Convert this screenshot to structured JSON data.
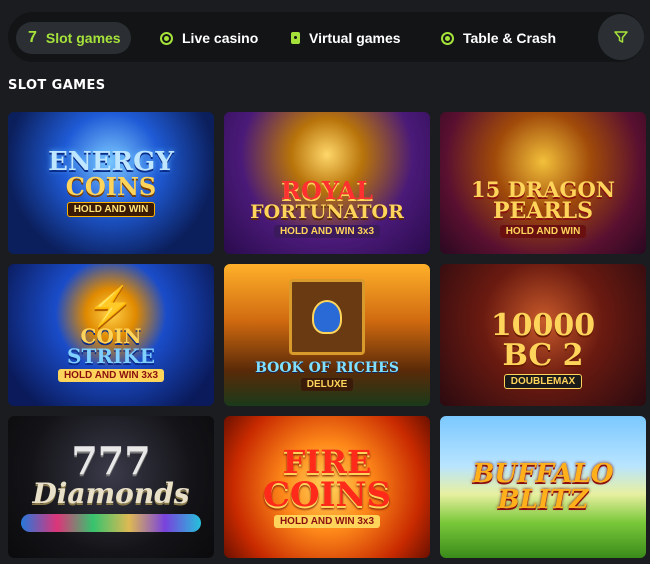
{
  "nav": {
    "tabs": [
      {
        "label": "Slot games",
        "icon": "seven-icon",
        "glyph": "7",
        "active": true
      },
      {
        "label": "Live casino",
        "icon": "live-icon",
        "active": false
      },
      {
        "label": "Virtual games",
        "icon": "dice-icon",
        "active": false
      },
      {
        "label": "Table & Crash",
        "icon": "chip-icon",
        "active": false
      }
    ],
    "filter_icon": "filter-icon"
  },
  "section": {
    "title": "SLOT GAMES"
  },
  "games": [
    {
      "title": "ENERGY",
      "subtitle": "COINS",
      "tagline": "HOLD AND WIN"
    },
    {
      "title": "ROYAL",
      "subtitle": "FORTUNATOR",
      "tagline": "HOLD AND WIN 3x3"
    },
    {
      "title": "15 DRAGON",
      "subtitle": "PEARLS",
      "tagline": "HOLD AND WIN"
    },
    {
      "title": "COIN",
      "subtitle": "STRIKE",
      "tagline": "HOLD AND WIN 3x3"
    },
    {
      "title": "BOOK OF RICHES",
      "subtitle": "DELUXE",
      "tagline": ""
    },
    {
      "title": "10000",
      "subtitle": "BC 2",
      "tagline": "DOUBLEMAX"
    },
    {
      "title": "777",
      "subtitle": "Diamonds",
      "tagline": ""
    },
    {
      "title": "FIRE",
      "subtitle": "COINS",
      "tagline": "HOLD AND WIN 3x3"
    },
    {
      "title": "BUFFALO BLITZ",
      "subtitle": "",
      "tagline": ""
    }
  ],
  "colors": {
    "accent": "#a6e33a",
    "background": "#1a1c1f",
    "bar": "#121416"
  }
}
